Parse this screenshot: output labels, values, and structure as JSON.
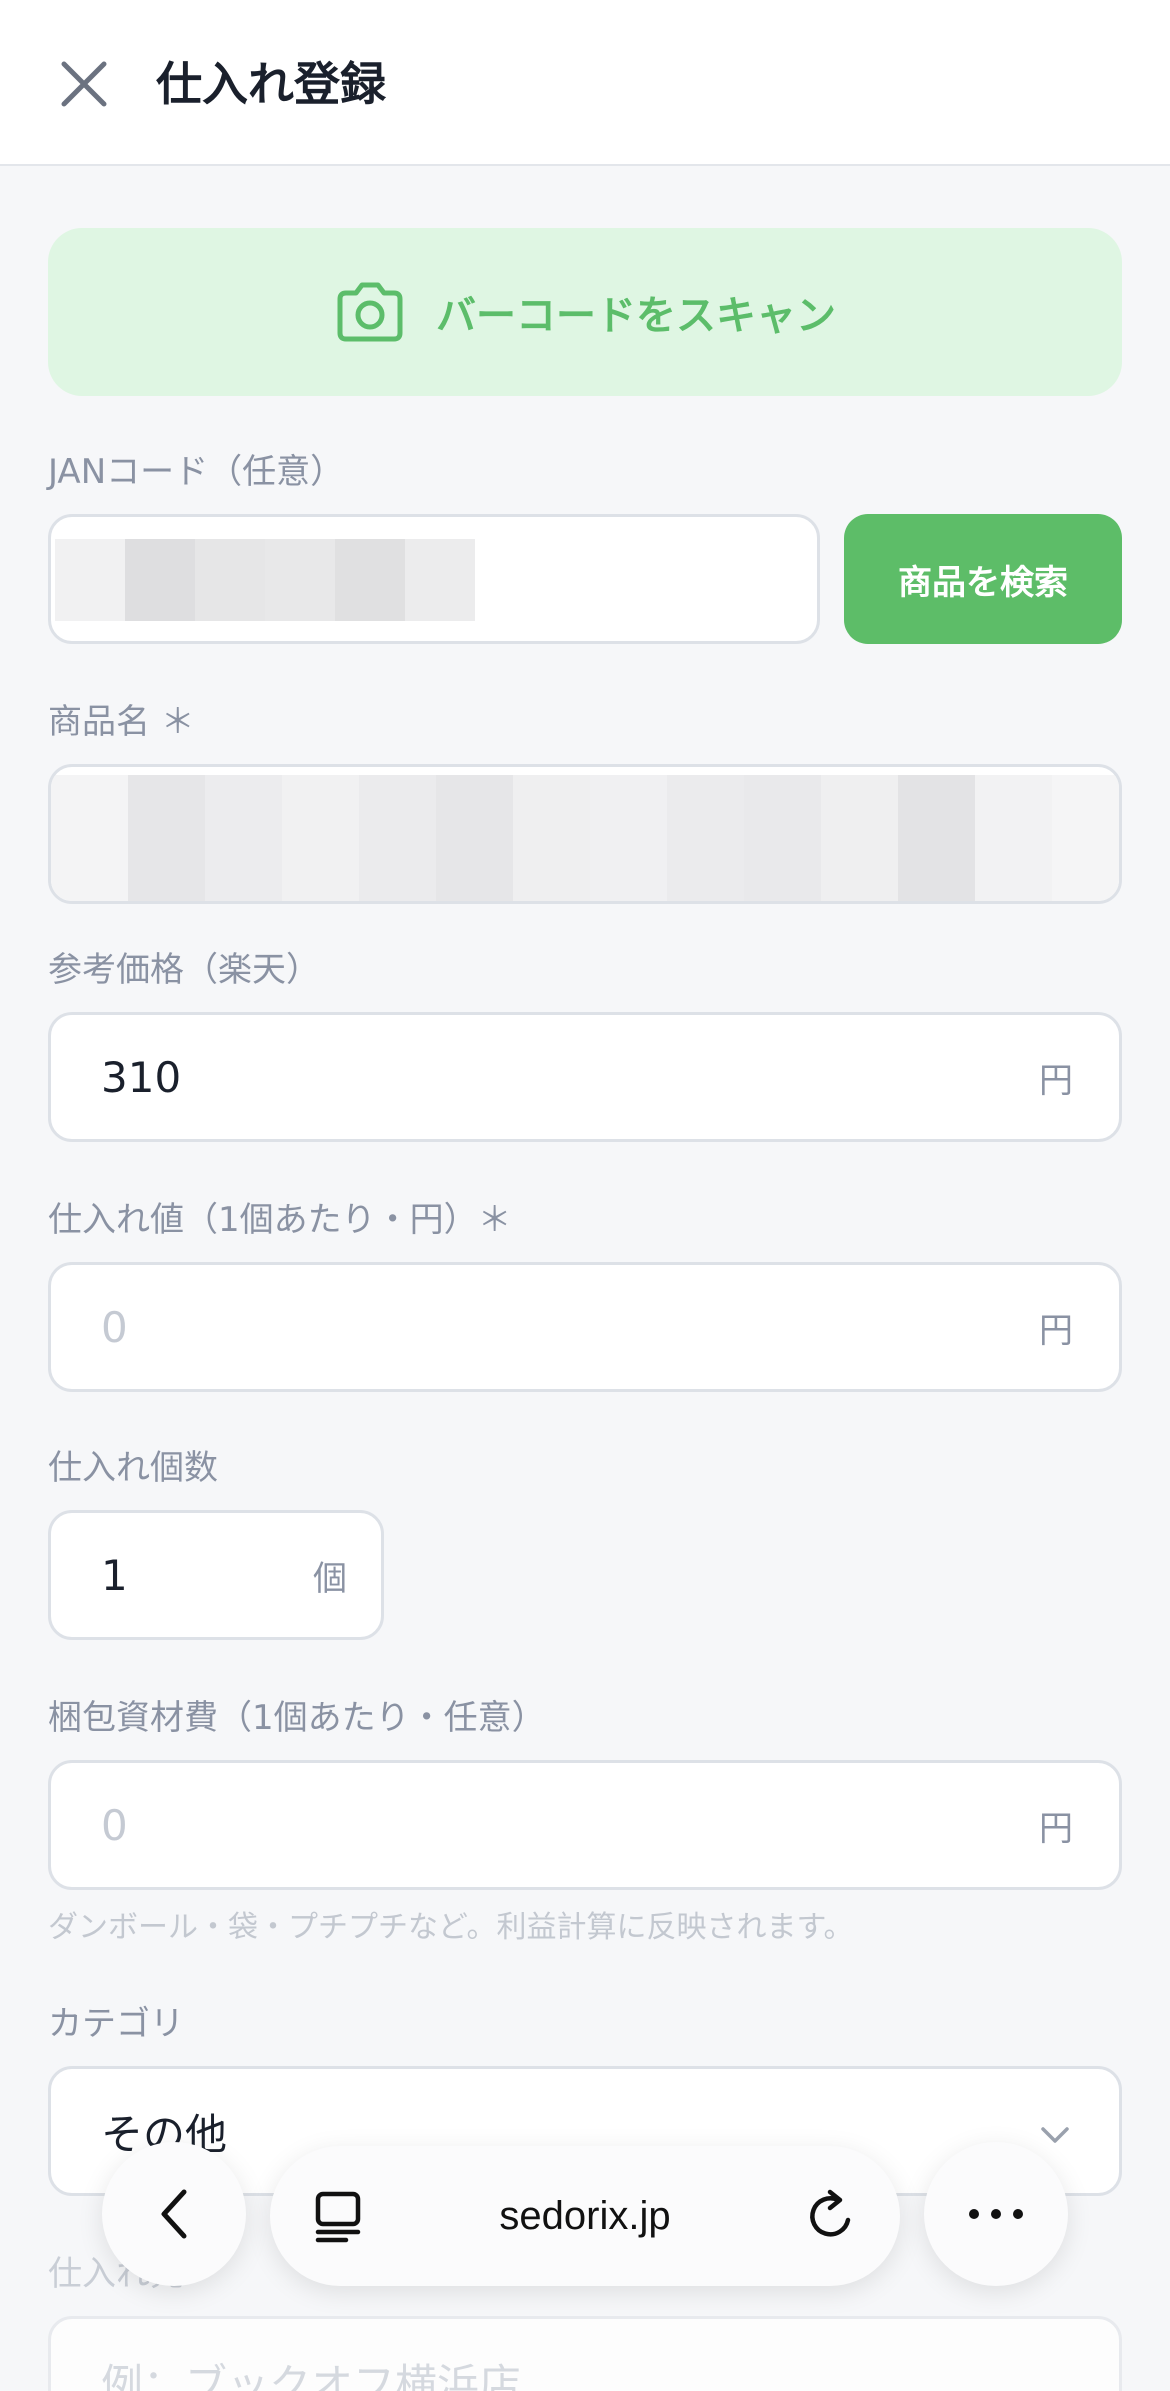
{
  "header": {
    "title": "仕入れ登録",
    "close_icon": "close-icon"
  },
  "scan": {
    "label": "バーコードをスキャン",
    "icon": "camera-icon",
    "color": "#5cbd6a"
  },
  "jan": {
    "label": "JANコード（任意）",
    "search_label": "商品を検索"
  },
  "product_name": {
    "label": "商品名 ＊"
  },
  "reference_price": {
    "label": "参考価格（楽天）",
    "value": "310",
    "unit": "円"
  },
  "purchase_price": {
    "label": "仕入れ値（1個あたり・円）＊",
    "placeholder": "0",
    "unit": "円"
  },
  "quantity": {
    "label": "仕入れ個数",
    "value": "1",
    "unit": "個"
  },
  "packing_cost": {
    "label": "梱包資材費（1個あたり・任意）",
    "placeholder": "0",
    "unit": "円",
    "hint": "ダンボール・袋・プチプチなど。利益計算に反映されます。"
  },
  "category": {
    "label": "カテゴリ",
    "selected": "その他"
  },
  "supplier": {
    "label": "仕入れ先",
    "placeholder": "例：ブックオフ横浜店"
  },
  "browser": {
    "url": "sedorix.jp"
  }
}
